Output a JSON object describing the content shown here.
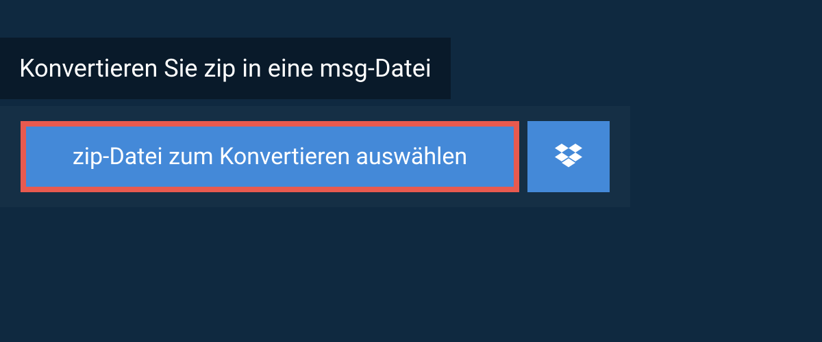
{
  "header": {
    "title": "Konvertieren Sie zip in eine msg-Datei"
  },
  "upload": {
    "select_file_label": "zip-Datei zum Konvertieren auswählen"
  }
}
